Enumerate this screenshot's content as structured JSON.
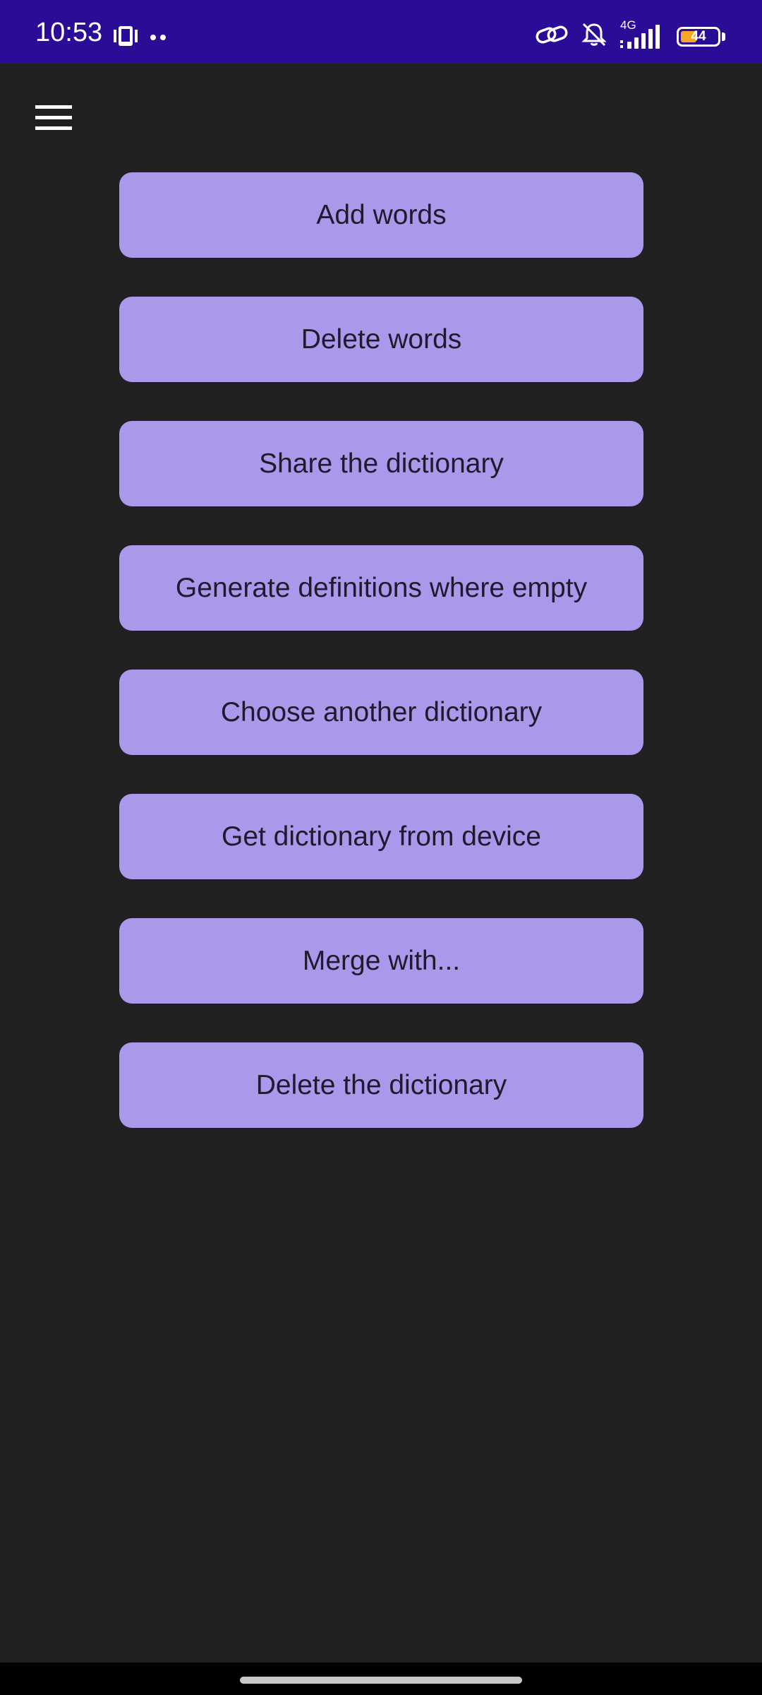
{
  "status_bar": {
    "time": "10:53",
    "network_type": "4G",
    "battery_level": "44",
    "left_icons": [
      "phone-vibrate-icon",
      "dots-icon"
    ],
    "right_icons": [
      "link-icon",
      "bell-off-icon",
      "signal-icon",
      "battery-icon"
    ],
    "background_color": "#2a0c96"
  },
  "toolbar": {
    "menu_icon": "hamburger-menu-icon"
  },
  "actions": [
    {
      "label": "Add words"
    },
    {
      "label": "Delete words"
    },
    {
      "label": "Share the dictionary"
    },
    {
      "label": "Generate definitions where empty"
    },
    {
      "label": "Choose another dictionary"
    },
    {
      "label": "Get dictionary from device"
    },
    {
      "label": "Merge with..."
    },
    {
      "label": "Delete the dictionary"
    }
  ],
  "colors": {
    "background": "#202020",
    "button": "#aa98eb",
    "button_text": "#1f1a2e"
  }
}
